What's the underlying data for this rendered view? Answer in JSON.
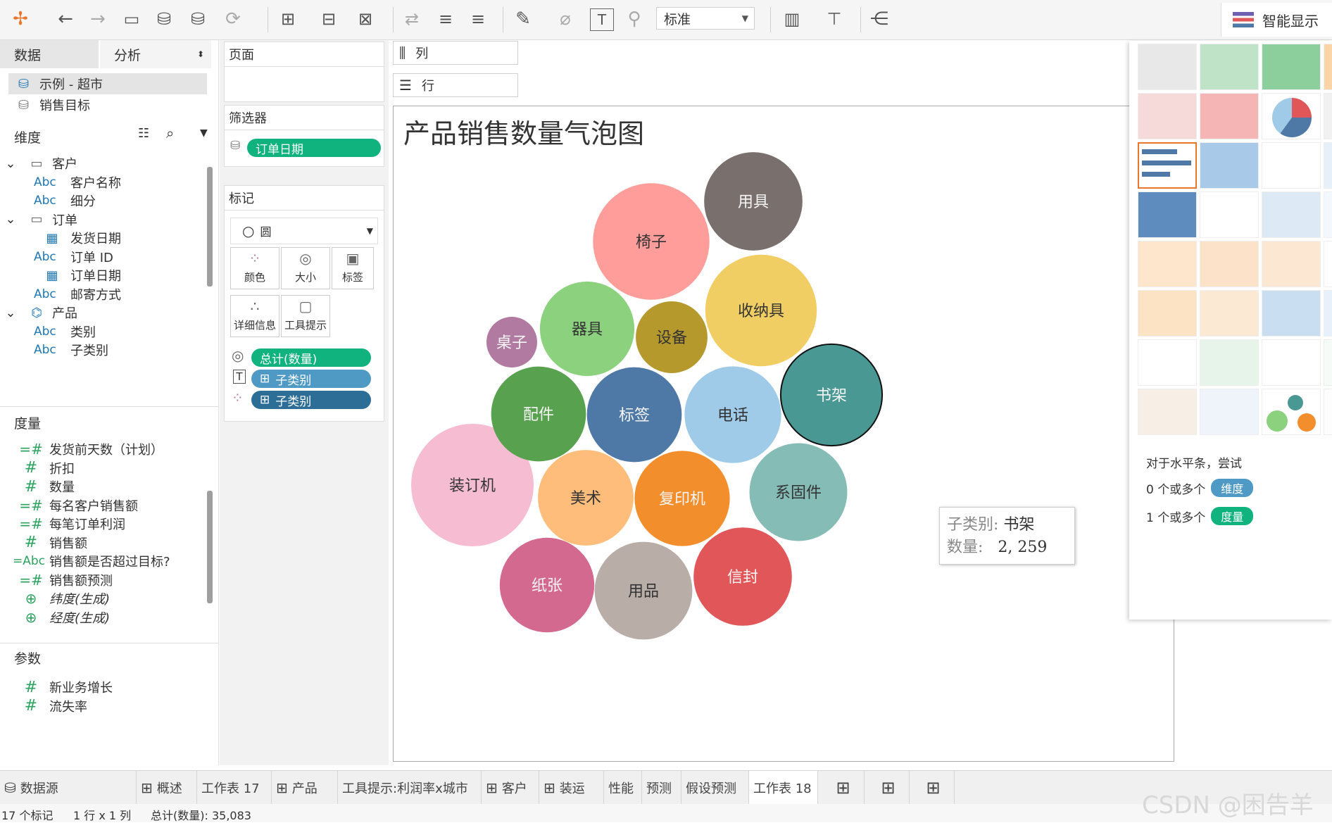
{
  "toolbar": {
    "style_select": "标准",
    "smart_show": "智能显示"
  },
  "left_pane": {
    "tabs": [
      "数据",
      "分析"
    ],
    "datasources": [
      "示例 - 超市",
      "销售目标"
    ],
    "dimensions_label": "维度",
    "dimensions": [
      {
        "type": "folder",
        "label": "客户"
      },
      {
        "type": "abc",
        "label": "客户名称"
      },
      {
        "type": "abc",
        "label": "细分"
      },
      {
        "type": "folder",
        "label": "订单"
      },
      {
        "type": "date",
        "label": "发货日期"
      },
      {
        "type": "abc",
        "label": "订单 ID"
      },
      {
        "type": "date",
        "label": "订单日期"
      },
      {
        "type": "abc",
        "label": "邮寄方式"
      },
      {
        "type": "hierarchy",
        "label": "产品"
      },
      {
        "type": "abc",
        "label": "类别"
      },
      {
        "type": "abc",
        "label": "子类别"
      }
    ],
    "measures_label": "度量",
    "measures": [
      {
        "icon": "=#",
        "label": "发货前天数（计划）"
      },
      {
        "icon": "#",
        "label": "折扣"
      },
      {
        "icon": "#",
        "label": "数量"
      },
      {
        "icon": "=#",
        "label": "每名客户销售额"
      },
      {
        "icon": "=#",
        "label": "每笔订单利润"
      },
      {
        "icon": "#",
        "label": "销售额"
      },
      {
        "icon": "=Abc",
        "label": "销售额是否超过目标?"
      },
      {
        "icon": "=#",
        "label": "销售额预测"
      },
      {
        "icon": "globe",
        "label": "纬度(生成)"
      },
      {
        "icon": "globe",
        "label": "经度(生成)"
      }
    ],
    "params_label": "参数",
    "params": [
      "新业务增长",
      "流失率"
    ]
  },
  "cards": {
    "pages": "页面",
    "filters": "筛选器",
    "filter_pill": "订单日期",
    "marks": "标记",
    "mark_type": "圆",
    "buttons": [
      "颜色",
      "大小",
      "标签",
      "详细信息",
      "工具提示"
    ],
    "pills": [
      "总计(数量)",
      "子类别",
      "子类别"
    ]
  },
  "shelves": {
    "columns": "列",
    "rows": "行"
  },
  "view": {
    "title": "产品销售数量气泡图",
    "tooltip": {
      "k1": "子类别:",
      "v1": "书架",
      "k2": "数量:",
      "v2": "2, 259"
    }
  },
  "chart_data": {
    "type": "bubble",
    "title": "产品销售数量气泡图",
    "measure": "数量",
    "total": 35083,
    "bubbles": [
      {
        "label": "装订机",
        "value": 5974,
        "color": "#f6bdd2"
      },
      {
        "label": "纸张",
        "value": 3563,
        "color": "#d4698f"
      },
      {
        "label": "用品",
        "value": 3801,
        "color": "#b9ada8"
      },
      {
        "label": "信封",
        "value": 3846,
        "color": "#e15659"
      },
      {
        "label": "美术",
        "value": 3640,
        "color": "#ffbd7b"
      },
      {
        "label": "复印机",
        "value": 3610,
        "color": "#f28e2b"
      },
      {
        "label": "系固件",
        "value": 3808,
        "color": "#86bcb6"
      },
      {
        "label": "配件",
        "value": 3580,
        "color": "#58a14e"
      },
      {
        "label": "标签",
        "value": 3580,
        "color": "#4e79a7"
      },
      {
        "label": "电话",
        "value": 3720,
        "color": "#a0cbe8"
      },
      {
        "label": "书架",
        "value": 4100,
        "color": "#499894"
      },
      {
        "label": "桌子",
        "value": 1000,
        "color": "#b07aa1"
      },
      {
        "label": "器具",
        "value": 3550,
        "color": "#8cd17d"
      },
      {
        "label": "设备",
        "value": 2048,
        "color": "#b6992d"
      },
      {
        "label": "收纳具",
        "value": 4950,
        "color": "#f1ce63"
      },
      {
        "label": "椅子",
        "value": 5400,
        "color": "#ff9d9a"
      },
      {
        "label": "用具",
        "value": 3850,
        "color": "#79706e"
      }
    ]
  },
  "show_me": {
    "hint": "对于水平条，尝试",
    "line1": "0 个或多个",
    "line1_tag": "维度",
    "line2": "1 个或多个",
    "line2_tag": "度量"
  },
  "tabs": [
    "数据源",
    "概述",
    "工作表 17",
    "产品",
    "工具提示:利润率x城市",
    "客户",
    "装运",
    "性能",
    "预测",
    "假设预测",
    "工作表 18"
  ],
  "status": {
    "marks": "17 个标记",
    "dims": "1 行 x 1 列",
    "sum": "总计(数量): 35,083"
  },
  "watermark": "CSDN @困告羊"
}
